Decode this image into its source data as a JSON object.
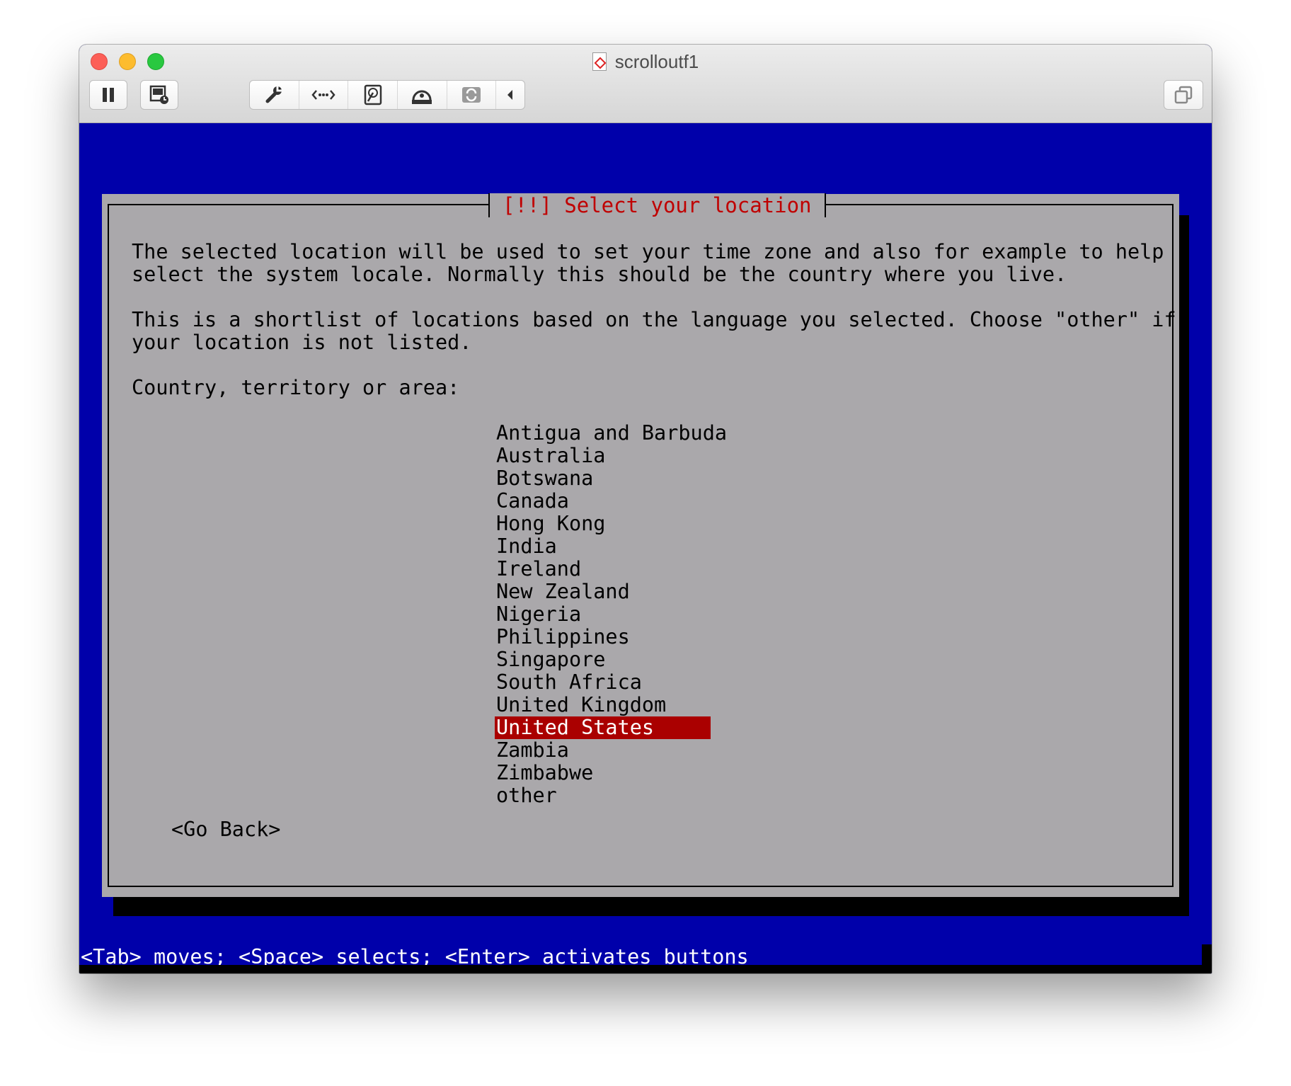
{
  "window": {
    "title": "scrolloutf1"
  },
  "toolbar": {
    "icons": [
      "pause-icon",
      "snapshot-icon",
      "settings-wrench-icon",
      "network-icon",
      "hard-disk-icon",
      "optical-drive-icon",
      "shared-folders-icon",
      "collapse-arrow-icon",
      "restore-window-icon"
    ]
  },
  "installer": {
    "dialog_title": "[!!] Select your location",
    "paragraph1_line1": "The selected location will be used to set your time zone and also for example to help",
    "paragraph1_line2": "select the system locale. Normally this should be the country where you live.",
    "paragraph2_line1": "This is a shortlist of locations based on the language you selected. Choose \"other\" if",
    "paragraph2_line2": "your location is not listed.",
    "prompt": "Country, territory or area:",
    "locations": [
      "Antigua and Barbuda",
      "Australia",
      "Botswana",
      "Canada",
      "Hong Kong",
      "India",
      "Ireland",
      "New Zealand",
      "Nigeria",
      "Philippines",
      "Singapore",
      "South Africa",
      "United Kingdom",
      "United States",
      "Zambia",
      "Zimbabwe",
      "other"
    ],
    "selected_location": "United States",
    "go_back": "<Go Back>",
    "status_help": "<Tab> moves; <Space> selects; <Enter> activates buttons"
  },
  "colors": {
    "screen_bg": "#0000aa",
    "dialog_bg": "#aaa8ab",
    "title_red": "#c00000",
    "selection_bg": "#aa0000"
  }
}
